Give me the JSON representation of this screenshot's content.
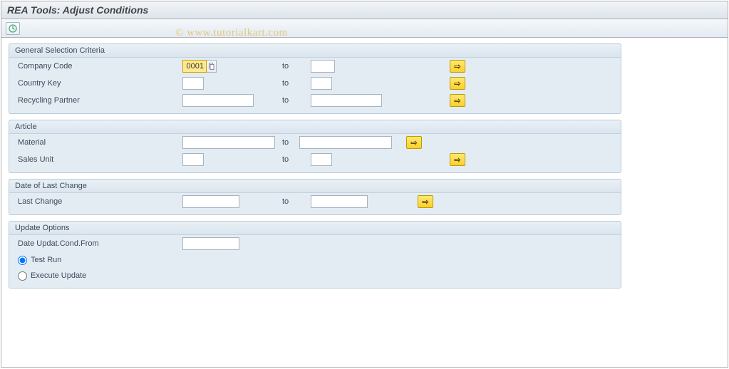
{
  "page_title": "REA Tools: Adjust Conditions",
  "watermark": "© www.tutorialkart.com",
  "to_label": "to",
  "groups": {
    "general": {
      "title": "General Selection Criteria",
      "company_code": {
        "label": "Company Code",
        "from": "0001",
        "to": ""
      },
      "country_key": {
        "label": "Country Key",
        "from": "",
        "to": ""
      },
      "recycling": {
        "label": "Recycling Partner",
        "from": "",
        "to": ""
      }
    },
    "article": {
      "title": "Article",
      "material": {
        "label": "Material",
        "from": "",
        "to": ""
      },
      "salesunit": {
        "label": "Sales Unit",
        "from": "",
        "to": ""
      }
    },
    "lastchange": {
      "title": "Date of Last Change",
      "last": {
        "label": "Last Change",
        "from": "",
        "to": ""
      }
    },
    "update": {
      "title": "Update Options",
      "datefrom": {
        "label": "Date Updat.Cond.From",
        "value": ""
      },
      "test_label": "Test Run",
      "exec_label": "Execute Update",
      "selected": "test"
    }
  }
}
